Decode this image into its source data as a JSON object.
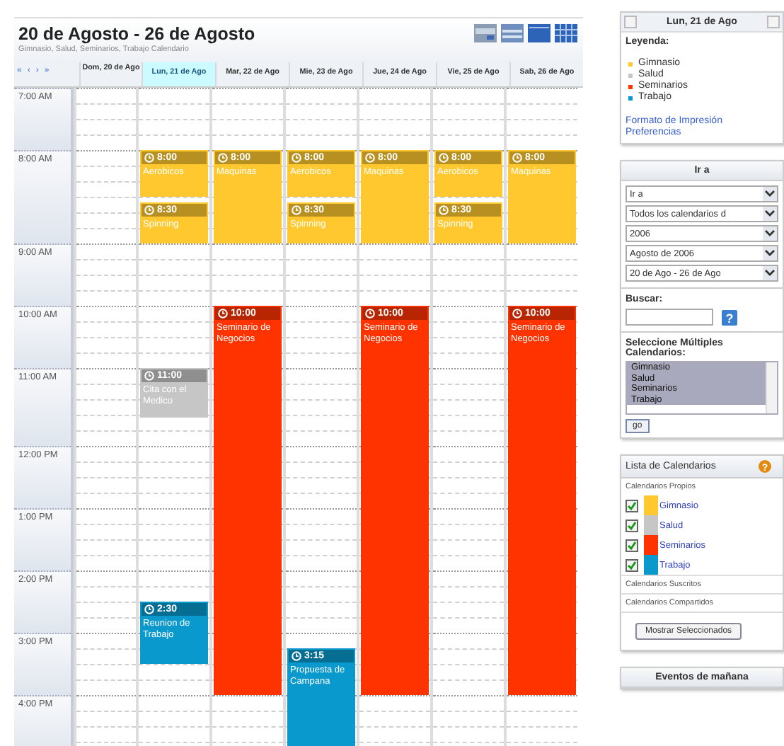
{
  "calendar": {
    "title": "20 de Agosto - 26 de Agosto",
    "subtitle": "Gimnasio, Salud, Seminarios, Trabajo Calendario",
    "nav": [
      "«",
      "‹",
      "›",
      "»"
    ],
    "days": [
      {
        "label": "Dom, 20 de Ago",
        "selected": false
      },
      {
        "label": "Lun, 21 de Ago",
        "selected": true,
        "events": [
          {
            "time": "8:00",
            "title": "Aerobicos",
            "color": "#ffc82e"
          },
          {
            "time": "8:30",
            "title": "Spinning",
            "color": "#ffc82e"
          },
          {
            "time": "11:00",
            "title": "Cita con el Medico",
            "color": "#c6c6c6"
          },
          {
            "time": "2:30",
            "title": "Reunion de Trabajo",
            "color": "#0a99cc"
          }
        ]
      },
      {
        "label": "Mar, 22 de Ago",
        "selected": false,
        "events": [
          {
            "time": "8:00",
            "title": "Maquinas",
            "color": "#ffc82e"
          },
          {
            "time": "10:00",
            "title": "Seminario de Negocios",
            "color": "#ff3300"
          }
        ]
      },
      {
        "label": "Mie, 23 de Ago",
        "selected": false,
        "events": [
          {
            "time": "8:00",
            "title": "Aerobicos",
            "color": "#ffc82e"
          },
          {
            "time": "8:30",
            "title": "Spinning",
            "color": "#ffc82e"
          },
          {
            "time": "3:15",
            "title": "Propuesta de Campana",
            "color": "#0a99cc"
          }
        ]
      },
      {
        "label": "Jue, 24 de Ago",
        "selected": false,
        "events": [
          {
            "time": "8:00",
            "title": "Maquinas",
            "color": "#ffc82e"
          },
          {
            "time": "10:00",
            "title": "Seminario de Negocios",
            "color": "#ff3300"
          }
        ]
      },
      {
        "label": "Vie, 25 de Ago",
        "selected": false,
        "events": [
          {
            "time": "8:00",
            "title": "Aerobicos",
            "color": "#ffc82e"
          },
          {
            "time": "8:30",
            "title": "Spinning",
            "color": "#ffc82e"
          }
        ]
      },
      {
        "label": "Sab, 26 de Ago",
        "selected": false,
        "events": [
          {
            "time": "8:00",
            "title": "Maquinas",
            "color": "#ffc82e"
          },
          {
            "time": "10:00",
            "title": "Seminario de Negocios",
            "color": "#ff3300"
          }
        ]
      }
    ],
    "hours": [
      "7:00 AM",
      "8:00 AM",
      "9:00 AM",
      "10:00 AM",
      "11:00 AM",
      "12:00 PM",
      "1:00 PM",
      "2:00 PM",
      "3:00 PM",
      "4:00 PM"
    ]
  },
  "sidebar": {
    "date": "Lun, 21 de Ago",
    "legend_title": "Leyenda:",
    "legend": [
      {
        "label": "Gimnasio",
        "color": "#ffc82e"
      },
      {
        "label": "Salud",
        "color": "#c6c6c6"
      },
      {
        "label": "Seminarios",
        "color": "#ff3300"
      },
      {
        "label": "Trabajo",
        "color": "#0a99cc"
      }
    ],
    "links": [
      "Formato de Impresión",
      "Preferencias"
    ],
    "goto": {
      "title": "Ir a",
      "selects": [
        "Ir a",
        "Todos los calendarios d",
        "2006",
        "Agosto de 2006",
        "20 de Ago - 26 de Ago"
      ],
      "search_label": "Buscar:",
      "search_help": "?",
      "multi_label": "Seleccione Múltiples Calendarios:",
      "multi_options": [
        "Gimnasio",
        "Salud",
        "Seminarios",
        "Trabajo"
      ],
      "go": "go"
    },
    "calendars": {
      "title": "Lista de Calendarios",
      "help": "?",
      "own": "Calendarios Propios",
      "items": [
        {
          "label": "Gimnasio",
          "checked": true,
          "color": "#ffc82e"
        },
        {
          "label": "Salud",
          "checked": true,
          "color": "#c6c6c6"
        },
        {
          "label": "Seminarios",
          "checked": true,
          "color": "#ff3300"
        },
        {
          "label": "Trabajo",
          "checked": true,
          "color": "#0a99cc"
        }
      ],
      "subscribed": "Calendarios Suscritos",
      "shared": "Calendarios Compartidos",
      "button": "Mostrar Seleccionados"
    },
    "tomorrow": {
      "title": "Eventos de mañana"
    }
  }
}
